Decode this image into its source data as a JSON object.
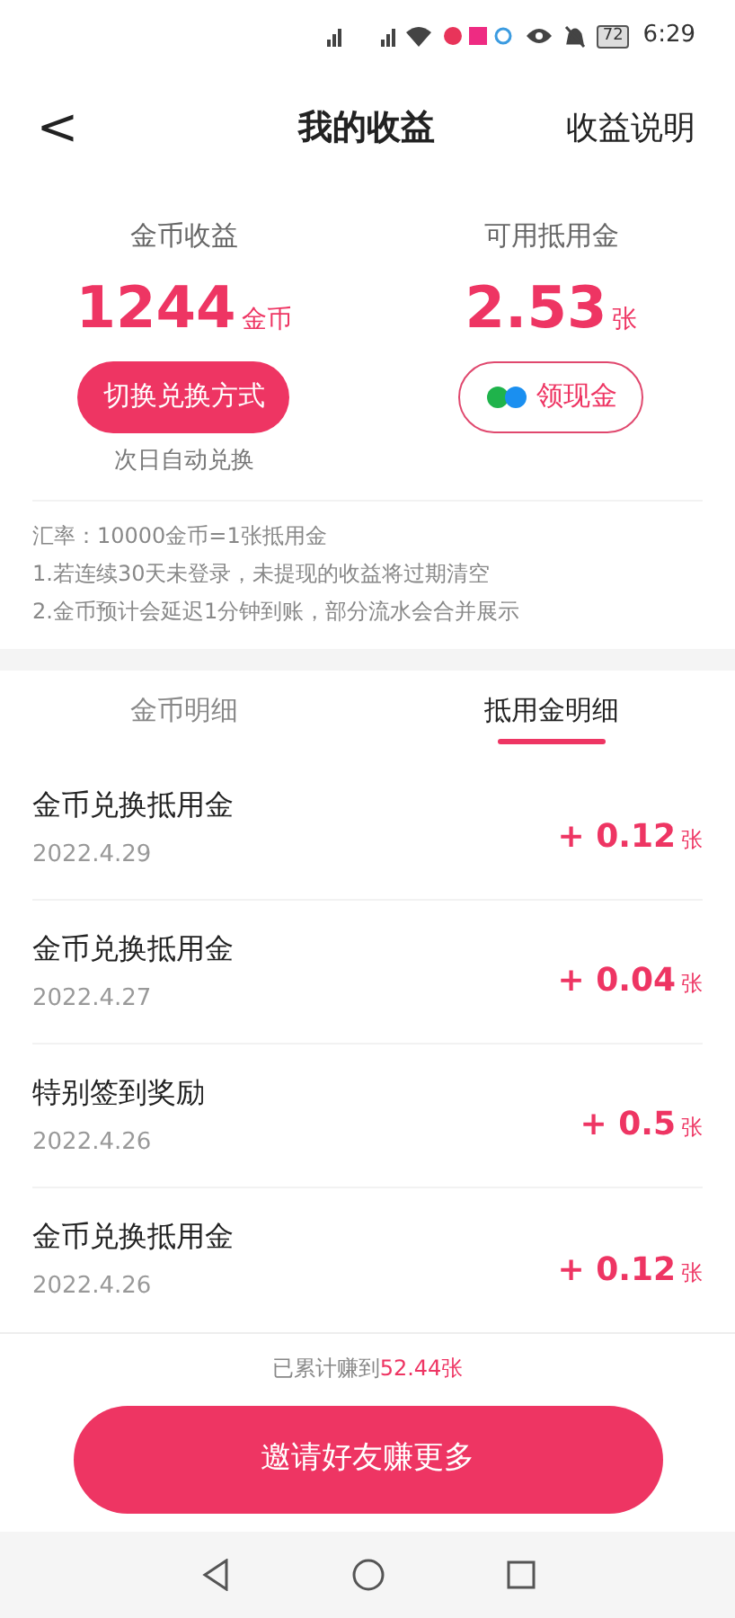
{
  "status_bar": {
    "battery": "72",
    "time": "6:29"
  },
  "header": {
    "back": "<",
    "title": "我的收益",
    "action": "收益说明"
  },
  "stats": [
    {
      "label": "金币收益",
      "value": "1244",
      "unit": "金币",
      "button": "切换兑换方式",
      "kind": "filled",
      "note": "次日自动兑换"
    },
    {
      "label": "可用抵用金",
      "value": "2.53",
      "unit": "张",
      "button": "领现金",
      "kind": "outline"
    }
  ],
  "notes": [
    "汇率：10000金币=1张抵用金",
    "1.若连续30天未登录，未提现的收益将过期清空",
    "2.金币预计会延迟1分钟到账，部分流水会合并展示"
  ],
  "tabs": [
    {
      "label": "金币明细",
      "selected": false
    },
    {
      "label": "抵用金明细",
      "selected": true
    }
  ],
  "records": [
    {
      "title": "金币兑换抵用金",
      "date": "2022.4.29",
      "amount": "+ 0.12",
      "unit": "张"
    },
    {
      "title": "金币兑换抵用金",
      "date": "2022.4.27",
      "amount": "+ 0.04",
      "unit": "张"
    },
    {
      "title": "特别签到奖励",
      "date": "2022.4.26",
      "amount": "+ 0.5",
      "unit": "张"
    },
    {
      "title": "金币兑换抵用金",
      "date": "2022.4.26",
      "amount": "+ 0.12",
      "unit": "张"
    }
  ],
  "footer": {
    "total_prefix": "已累计赚到",
    "total": "52.44张",
    "button": "邀请好友赚更多"
  }
}
